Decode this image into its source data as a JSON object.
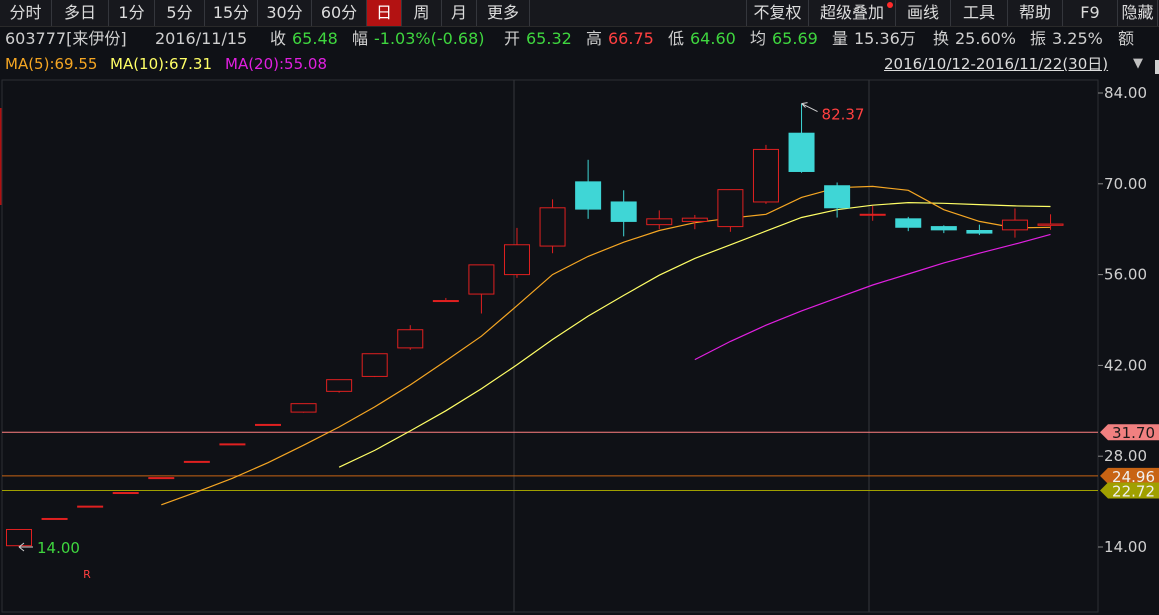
{
  "toolbar": {
    "left_items": [
      "分时",
      "多日",
      "1分",
      "5分",
      "15分",
      "30分",
      "60分",
      "日",
      "周",
      "月",
      "更多"
    ],
    "active": "日",
    "right_items": [
      "不复权",
      "超级叠加",
      "画线",
      "工具",
      "帮助",
      "F9",
      "隐藏"
    ]
  },
  "info": {
    "code": "603777[来伊份]",
    "date": "2016/11/15",
    "close_label": "收",
    "close": "65.48",
    "change_label": "幅",
    "change": "-1.03%(-0.68)",
    "open_label": "开",
    "open": "65.32",
    "high_label": "高",
    "high": "66.75",
    "low_label": "低",
    "low": "64.60",
    "avg_label": "均",
    "avg": "65.69",
    "volume_label": "量",
    "volume": "15.36万",
    "turnover_label": "换",
    "turnover": "25.60%",
    "amplitude_label": "振",
    "amplitude": "3.25%",
    "amount_label": "额"
  },
  "ma_legend": {
    "ma5": "MA(5):69.55",
    "ma10": "MA(10):67.31",
    "ma20": "MA(20):55.08",
    "range": "2016/10/12-2016/11/22(30日)"
  },
  "colors": {
    "up": "#e02020",
    "down": "#3fd6d6",
    "ma5": "#f5a623",
    "ma10": "#ffff66",
    "ma20": "#e020e0",
    "line_pink": "#ff8080",
    "line_orange": "#c86414",
    "line_olive": "#a0a000",
    "grid": "#26282e",
    "axis_text": "#d0d0d0"
  },
  "chart_data": {
    "type": "candlestick",
    "ylim": [
      7,
      86
    ],
    "y_ticks": [
      14.0,
      28.0,
      42.0,
      56.0,
      70.0,
      84.0
    ],
    "candles": [
      {
        "o": 14.2,
        "h": 16.7,
        "l": 14.0,
        "c": 16.7
      },
      {
        "o": 18.3,
        "h": 18.4,
        "l": 18.3,
        "c": 18.4
      },
      {
        "o": 20.2,
        "h": 20.3,
        "l": 20.2,
        "c": 20.3
      },
      {
        "o": 22.3,
        "h": 22.4,
        "l": 22.3,
        "c": 22.4
      },
      {
        "o": 24.6,
        "h": 24.7,
        "l": 24.6,
        "c": 24.7
      },
      {
        "o": 27.1,
        "h": 27.2,
        "l": 27.1,
        "c": 27.2
      },
      {
        "o": 29.8,
        "h": 29.9,
        "l": 29.8,
        "c": 29.9
      },
      {
        "o": 32.8,
        "h": 32.9,
        "l": 32.8,
        "c": 32.9
      },
      {
        "o": 34.8,
        "h": 36.1,
        "l": 34.7,
        "c": 36.1
      },
      {
        "o": 38.0,
        "h": 39.8,
        "l": 37.8,
        "c": 39.8
      },
      {
        "o": 40.3,
        "h": 43.8,
        "l": 40.2,
        "c": 43.8
      },
      {
        "o": 44.7,
        "h": 48.2,
        "l": 44.4,
        "c": 47.5
      },
      {
        "o": 52.0,
        "h": 52.4,
        "l": 51.9,
        "c": 52.0
      },
      {
        "o": 53.0,
        "h": 57.5,
        "l": 50.0,
        "c": 57.5
      },
      {
        "o": 56.0,
        "h": 63.2,
        "l": 55.5,
        "c": 60.6
      },
      {
        "o": 60.4,
        "h": 67.6,
        "l": 59.3,
        "c": 66.3
      },
      {
        "o": 70.3,
        "h": 73.7,
        "l": 64.6,
        "c": 66.1
      },
      {
        "o": 67.2,
        "h": 69.0,
        "l": 61.9,
        "c": 64.2
      },
      {
        "o": 63.7,
        "h": 65.9,
        "l": 63.0,
        "c": 64.6
      },
      {
        "o": 64.2,
        "h": 65.2,
        "l": 63.0,
        "c": 64.7
      },
      {
        "o": 63.4,
        "h": 67.3,
        "l": 62.6,
        "c": 69.1
      },
      {
        "o": 67.2,
        "h": 76.0,
        "l": 66.9,
        "c": 75.3
      },
      {
        "o": 77.8,
        "h": 82.37,
        "l": 71.7,
        "c": 71.9
      },
      {
        "o": 69.7,
        "h": 70.2,
        "l": 64.8,
        "c": 66.3
      },
      {
        "o": 65.3,
        "h": 66.6,
        "l": 64.3,
        "c": 65.3
      },
      {
        "o": 64.6,
        "h": 64.9,
        "l": 62.7,
        "c": 63.3
      },
      {
        "o": 63.4,
        "h": 63.6,
        "l": 62.4,
        "c": 62.9
      },
      {
        "o": 62.8,
        "h": 63.7,
        "l": 62.1,
        "c": 62.4
      },
      {
        "o": 62.9,
        "h": 66.2,
        "l": 61.7,
        "c": 64.4
      },
      {
        "o": 63.6,
        "h": 65.3,
        "l": 62.9,
        "c": 63.8
      }
    ],
    "ma5": [
      null,
      null,
      null,
      null,
      20.5,
      22.5,
      24.6,
      27.0,
      29.7,
      32.5,
      35.6,
      39.0,
      42.7,
      46.5,
      51.2,
      56.0,
      58.8,
      61.0,
      62.8,
      64.0,
      64.7,
      65.3,
      67.9,
      69.4,
      69.6,
      69.0,
      66.0,
      64.2,
      63.2,
      63.3
    ],
    "ma10": [
      null,
      null,
      null,
      null,
      null,
      null,
      null,
      null,
      null,
      26.3,
      28.9,
      31.9,
      35.0,
      38.4,
      42.1,
      46.0,
      49.6,
      52.8,
      55.9,
      58.5,
      60.6,
      62.7,
      64.8,
      66.0,
      66.7,
      67.1,
      67.0,
      66.8,
      66.6,
      66.5
    ],
    "ma20": [
      null,
      null,
      null,
      null,
      null,
      null,
      null,
      null,
      null,
      null,
      null,
      null,
      null,
      null,
      null,
      null,
      null,
      null,
      null,
      42.9,
      45.7,
      48.2,
      50.4,
      52.4,
      54.4,
      56.1,
      57.8,
      59.3,
      60.7,
      62.2
    ],
    "horizontal_lines": [
      {
        "value": 31.7,
        "label": "31.70"
      },
      {
        "value": 24.96,
        "label": "24.96"
      },
      {
        "value": 22.72,
        "label": "22.72"
      }
    ],
    "annotations": {
      "max": {
        "index": 22,
        "value": 82.37,
        "label": "82.37"
      },
      "min": {
        "index": 0,
        "value": 14.0,
        "label": "14.00"
      },
      "marker": "R"
    }
  }
}
